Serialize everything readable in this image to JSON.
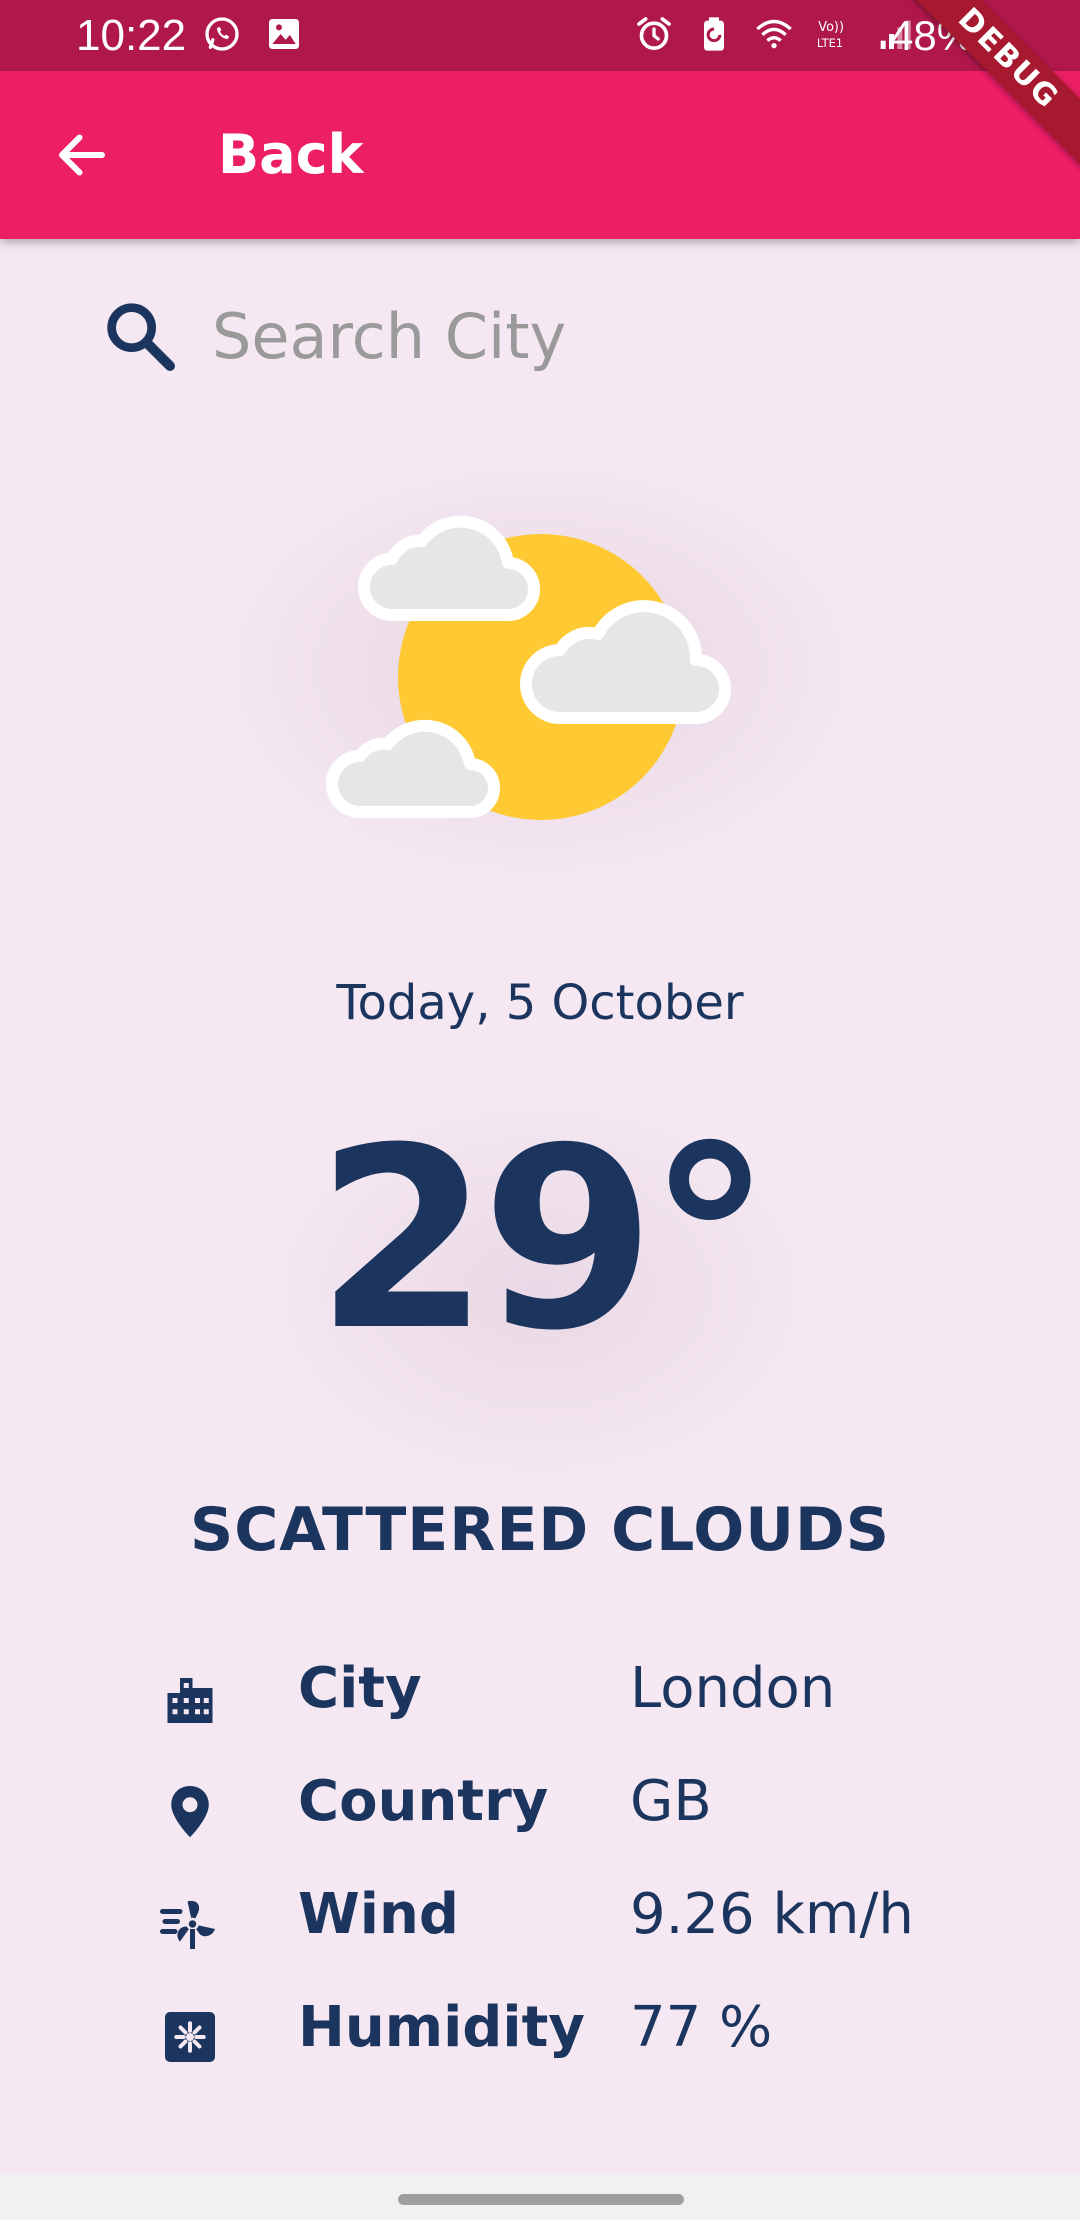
{
  "status_bar": {
    "time": "10:22",
    "battery": "48%",
    "left_icons": [
      "whatsapp-icon",
      "image-icon"
    ],
    "right_icons": [
      "alarm-icon",
      "battery-saver-icon",
      "wifi-icon",
      "volte-icon",
      "signal-icon"
    ]
  },
  "app_bar": {
    "title": "Back",
    "back_icon": "arrow-left-icon",
    "color": "#EC1E64"
  },
  "debug_banner": "DEBUG",
  "search": {
    "placeholder": "Search City",
    "value": "",
    "icon": "search-icon"
  },
  "weather": {
    "illustration": "sun-with-clouds",
    "date": "Today, 5 October",
    "temperature": "29°",
    "condition": "SCATTERED CLOUDS"
  },
  "details": [
    {
      "icon": "city-icon",
      "label": "City",
      "value": "London"
    },
    {
      "icon": "location-pin-icon",
      "label": "Country",
      "value": "GB"
    },
    {
      "icon": "wind-icon",
      "label": "Wind",
      "value": "9.26 km/h"
    },
    {
      "icon": "humidity-icon",
      "label": "Humidity",
      "value": "77 %"
    }
  ],
  "colors": {
    "status_bar": "#B0184B",
    "app_bar": "#EC1E64",
    "background": "#F5E8F2",
    "text": "#1C355E",
    "sun": "#FFC933",
    "cloud": "#E6E6E6"
  }
}
